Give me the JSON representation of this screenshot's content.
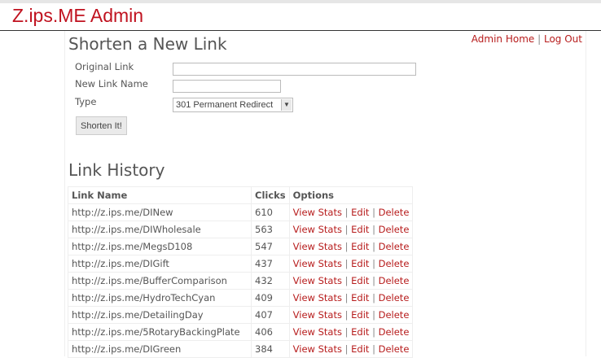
{
  "brand": "Z.ips.ME Admin",
  "nav": {
    "home": "Admin Home",
    "sep": "|",
    "logout": "Log Out"
  },
  "form": {
    "title": "Shorten a New Link",
    "original_label": "Original Link",
    "original_value": "",
    "name_label": "New Link Name",
    "name_value": "",
    "type_label": "Type",
    "type_value": "301 Permanent Redirect",
    "submit": "Shorten It!"
  },
  "history": {
    "title": "Link History",
    "columns": [
      "Link Name",
      "Clicks",
      "Options"
    ],
    "actions": {
      "stats": "View Stats",
      "edit": "Edit",
      "delete": "Delete",
      "sep": "|"
    },
    "rows": [
      {
        "name": "http://z.ips.me/DINew",
        "clicks": "610"
      },
      {
        "name": "http://z.ips.me/DIWholesale",
        "clicks": "563"
      },
      {
        "name": "http://z.ips.me/MegsD108",
        "clicks": "547"
      },
      {
        "name": "http://z.ips.me/DIGift",
        "clicks": "437"
      },
      {
        "name": "http://z.ips.me/BufferComparison",
        "clicks": "432"
      },
      {
        "name": "http://z.ips.me/HydroTechCyan",
        "clicks": "409"
      },
      {
        "name": "http://z.ips.me/DetailingDay",
        "clicks": "407"
      },
      {
        "name": "http://z.ips.me/5RotaryBackingPlate",
        "clicks": "406"
      },
      {
        "name": "http://z.ips.me/DIGreen",
        "clicks": "384"
      }
    ]
  },
  "colors": {
    "accent": "#c0121f"
  }
}
